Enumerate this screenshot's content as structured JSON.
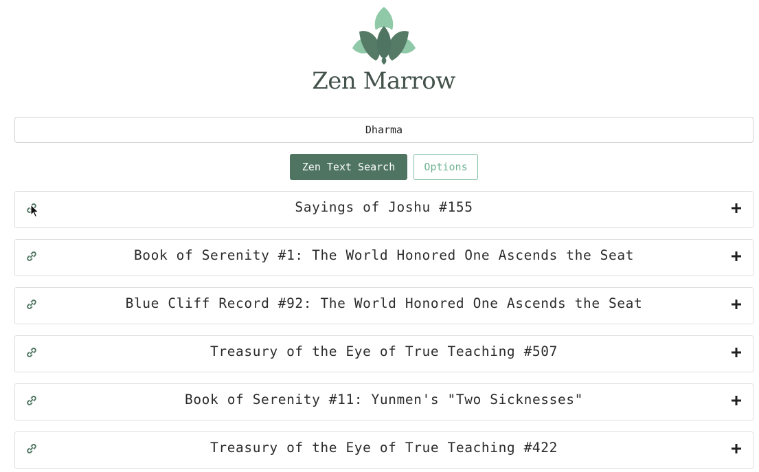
{
  "brand": {
    "name": "Zen Marrow",
    "logo_icon": "lotus-icon",
    "colors": {
      "light_green": "#8fc9a8",
      "dark_green": "#4f7562"
    }
  },
  "search": {
    "value": "Dharma"
  },
  "buttons": {
    "search_label": "Zen Text Search",
    "options_label": "Options"
  },
  "results": [
    {
      "title": "Sayings of Joshu #155",
      "link_icon": "link-icon",
      "expand_icon": "plus-icon"
    },
    {
      "title": "Book of Serenity #1: The World Honored One Ascends the Seat",
      "link_icon": "link-icon",
      "expand_icon": "plus-icon"
    },
    {
      "title": "Blue Cliff Record #92: The World Honored One Ascends the Seat",
      "link_icon": "link-icon",
      "expand_icon": "plus-icon"
    },
    {
      "title": "Treasury of the Eye of True Teaching #507",
      "link_icon": "link-icon",
      "expand_icon": "plus-icon"
    },
    {
      "title": "Book of Serenity #11: Yunmen's \"Two Sicknesses\"",
      "link_icon": "link-icon",
      "expand_icon": "plus-icon"
    },
    {
      "title": "Treasury of the Eye of True Teaching #422",
      "link_icon": "link-icon",
      "expand_icon": "plus-icon"
    }
  ]
}
